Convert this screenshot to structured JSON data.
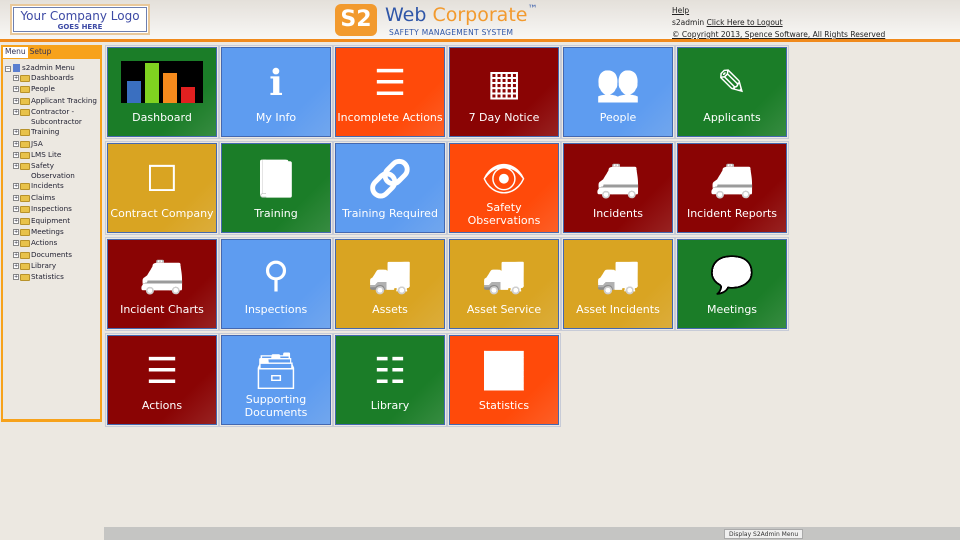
{
  "header": {
    "logo_line1": "Your Company Logo",
    "logo_line2": "GOES HERE",
    "brand_mark": "S2",
    "brand_web": "Web",
    "brand_corporate": " Corporate",
    "brand_tm": "™",
    "brand_subtitle": "SAFETY MANAGEMENT SYSTEM",
    "help": "Help",
    "username": "s2admin",
    "logout": "Click Here to Logout",
    "copyright": "© Copyright 2013, Spence Software, All Rights Reserved"
  },
  "sidebar": {
    "tabs": [
      "Menu",
      "Setup"
    ],
    "root": "s2admin Menu",
    "items": [
      "Dashboards",
      "People",
      "Applicant Tracking",
      "Contractor - Subcontractor",
      "Training",
      "JSA",
      "LMS Lite",
      "Safety Observation",
      "Incidents",
      "Claims",
      "Inspections",
      "Equipment",
      "Meetings",
      "Actions",
      "Documents",
      "Library",
      "Statistics"
    ]
  },
  "colors": {
    "green": "#1b7d28",
    "blue": "#5e9cf0",
    "orange": "#ff4a0a",
    "darkred": "#8a0404",
    "gold": "#d9a422",
    "accent": "#f08a1c"
  },
  "tiles": [
    {
      "label": "Dashboard",
      "color": "green",
      "icon": "bar-chart-icon"
    },
    {
      "label": "My Info",
      "color": "blue",
      "icon": "info-icon"
    },
    {
      "label": "Incomplete Actions",
      "color": "orange",
      "icon": "list-icon"
    },
    {
      "label": "7 Day Notice",
      "color": "darkred",
      "icon": "calendar-icon"
    },
    {
      "label": "People",
      "color": "blue",
      "icon": "users-icon"
    },
    {
      "label": "Applicants",
      "color": "green",
      "icon": "pencil-icon"
    },
    {
      "label": "Contract Company",
      "color": "gold",
      "icon": "calendar-blank-icon"
    },
    {
      "label": "Training",
      "color": "green",
      "icon": "book-icon"
    },
    {
      "label": "Training Required",
      "color": "blue",
      "icon": "chain-link-icon"
    },
    {
      "label": "Safety Observations",
      "color": "orange",
      "icon": "eye-icon"
    },
    {
      "label": "Incidents",
      "color": "darkred",
      "icon": "ambulance-icon"
    },
    {
      "label": "Incident Reports",
      "color": "darkred",
      "icon": "ambulance-icon"
    },
    {
      "label": "Incident Charts",
      "color": "darkred",
      "icon": "ambulance-icon"
    },
    {
      "label": "Inspections",
      "color": "blue",
      "icon": "search-icon"
    },
    {
      "label": "Assets",
      "color": "gold",
      "icon": "truck-icon"
    },
    {
      "label": "Asset Service",
      "color": "gold",
      "icon": "truck-icon"
    },
    {
      "label": "Asset Incidents",
      "color": "gold",
      "icon": "truck-icon"
    },
    {
      "label": "Meetings",
      "color": "green",
      "icon": "chat-bubbles-icon"
    },
    {
      "label": "Actions",
      "color": "darkred",
      "icon": "list-icon"
    },
    {
      "label": "Supporting Documents",
      "color": "blue",
      "icon": "archive-box-icon"
    },
    {
      "label": "Library",
      "color": "green",
      "icon": "stack-icon"
    },
    {
      "label": "Statistics",
      "color": "orange",
      "icon": "stats-icon"
    }
  ],
  "footer": {
    "button": "Display S2Admin Menu"
  }
}
